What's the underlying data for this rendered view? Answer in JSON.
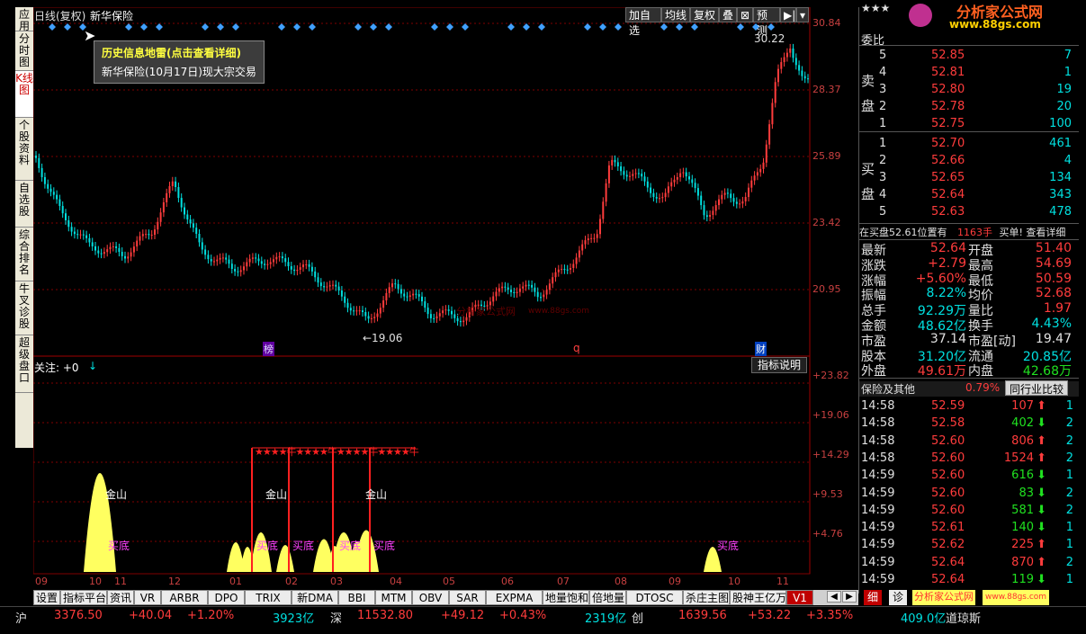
{
  "header": {
    "period": "日线(复权)",
    "stock": "新华保险",
    "buttons": [
      "加自选",
      "均线",
      "复权",
      "叠",
      "⊠",
      "预测",
      "▶|",
      "▾"
    ]
  },
  "left_tabs": [
    "应用",
    "分时图",
    "K线图",
    "个股资料",
    "自选股",
    "综合排名",
    "牛叉诊股",
    "超级盘口"
  ],
  "active_left_tab": 2,
  "tooltip": {
    "title": "历史信息地雷(点击查看详细)",
    "body": "新华保险(10月17日)现大宗交易"
  },
  "price_axis": [
    "30.84",
    "28.37",
    "25.89",
    "23.42",
    "20.95"
  ],
  "price_marks": {
    "high": "30.22",
    "low": "←19.06"
  },
  "events": [
    "榜",
    "q",
    "财"
  ],
  "indicator": {
    "label": "关注: +0",
    "explain": "指标说明",
    "axis": [
      "+23.82",
      "+19.06",
      "+14.29",
      "+9.53",
      "+4.76"
    ],
    "jinshan": "金山",
    "maidi": "买底",
    "stars": "★★★★牛★★★★牛★★★★牛★★★★牛"
  },
  "months": [
    "09",
    "10",
    "11",
    "12",
    "01",
    "02",
    "03",
    "04",
    "05",
    "06",
    "07",
    "08",
    "09",
    "10",
    "11"
  ],
  "watermark": "分析家公式网",
  "watermark_small": "www.88gs.com",
  "brand": {
    "name": "分析家公式网",
    "url": "www.88gs.com",
    "stars": "★★★"
  },
  "bottom_tabs": [
    "设置",
    "指标平台",
    "资讯",
    "VR",
    "ARBR",
    "DPO",
    "TRIX",
    "新DMA",
    "BBI",
    "MTM",
    "OBV",
    "SAR",
    "EXPMA",
    "地量饱和",
    "倍地量",
    "DTOSC",
    "杀庄主图",
    "股神王亿万",
    "V1"
  ],
  "bottom_right_tabs": [
    "细",
    "诊"
  ],
  "bottom_brand": "分析家公式网",
  "bottom_brand_url": "www.88gs.com",
  "orderbook": {
    "title": "委比",
    "sell_label": "卖盘",
    "buy_label": "买盘",
    "sells": [
      {
        "n": "5",
        "p": "52.85",
        "v": "7"
      },
      {
        "n": "4",
        "p": "52.81",
        "v": "1"
      },
      {
        "n": "3",
        "p": "52.80",
        "v": "19"
      },
      {
        "n": "2",
        "p": "52.78",
        "v": "20"
      },
      {
        "n": "1",
        "p": "52.75",
        "v": "100"
      }
    ],
    "buys": [
      {
        "n": "1",
        "p": "52.70",
        "v": "461"
      },
      {
        "n": "2",
        "p": "52.66",
        "v": "4"
      },
      {
        "n": "3",
        "p": "52.65",
        "v": "134"
      },
      {
        "n": "4",
        "p": "52.64",
        "v": "343"
      },
      {
        "n": "5",
        "p": "52.63",
        "v": "478"
      }
    ]
  },
  "notice": {
    "a": "在买盘52.61位置有",
    "b": "1163手",
    "c": "买单! 查看详细"
  },
  "stats": [
    {
      "l1": "最新",
      "v1": "52.64",
      "c1": "c-red",
      "l2": "开盘",
      "v2": "51.40",
      "c2": "c-red"
    },
    {
      "l1": "涨跌",
      "v1": "+2.79",
      "c1": "c-red",
      "l2": "最高",
      "v2": "54.69",
      "c2": "c-red"
    },
    {
      "l1": "涨幅",
      "v1": "+5.60%",
      "c1": "c-red",
      "l2": "最低",
      "v2": "50.59",
      "c2": "c-red"
    },
    {
      "l1": "振幅",
      "v1": "8.22%",
      "c1": "c-cy",
      "l2": "均价",
      "v2": "52.68",
      "c2": "c-red"
    },
    {
      "l1": "总手",
      "v1": "92.29万",
      "c1": "c-cy",
      "l2": "量比",
      "v2": "1.97",
      "c2": "c-red"
    },
    {
      "l1": "金额",
      "v1": "48.62亿",
      "c1": "c-cy",
      "l2": "换手",
      "v2": "4.43%",
      "c2": "c-cy"
    },
    {
      "l1": "市盈",
      "v1": "37.14",
      "c1": "c-wh",
      "l2": "市盈[动]",
      "v2": "19.47",
      "c2": "c-wh"
    },
    {
      "l1": "股本",
      "v1": "31.20亿",
      "c1": "c-cy",
      "l2": "流通",
      "v2": "20.85亿",
      "c2": "c-cy"
    },
    {
      "l1": "外盘",
      "v1": "49.61万",
      "c1": "c-red",
      "l2": "内盘",
      "v2": "42.68万",
      "c2": "c-grn"
    }
  ],
  "sector": {
    "name": "保险及其他",
    "pct": "0.79%",
    "btn": "同行业比较"
  },
  "ticks": [
    {
      "t": "14:58",
      "p": "52.59",
      "v": "107",
      "d": "up",
      "n": "1"
    },
    {
      "t": "14:58",
      "p": "52.58",
      "v": "402",
      "d": "down",
      "n": "2"
    },
    {
      "t": "14:58",
      "p": "52.60",
      "v": "806",
      "d": "up",
      "n": "2"
    },
    {
      "t": "14:58",
      "p": "52.60",
      "v": "1524",
      "d": "up",
      "n": "2"
    },
    {
      "t": "14:59",
      "p": "52.60",
      "v": "616",
      "d": "down",
      "n": "1"
    },
    {
      "t": "14:59",
      "p": "52.60",
      "v": "83",
      "d": "down",
      "n": "2"
    },
    {
      "t": "14:59",
      "p": "52.60",
      "v": "581",
      "d": "down",
      "n": "2"
    },
    {
      "t": "14:59",
      "p": "52.61",
      "v": "140",
      "d": "down",
      "n": "1"
    },
    {
      "t": "14:59",
      "p": "52.62",
      "v": "225",
      "d": "up",
      "n": "1"
    },
    {
      "t": "14:59",
      "p": "52.64",
      "v": "870",
      "d": "up",
      "n": "2"
    },
    {
      "t": "14:59",
      "p": "52.64",
      "v": "119",
      "d": "down",
      "n": "1"
    }
  ],
  "status": {
    "sh": "沪",
    "sh_v": "3376.50",
    "sh_c": "+40.04",
    "sh_p": "+1.20%",
    "sh_amt": "3923亿",
    "sz": "深",
    "sz_v": "11532.80",
    "sz_c": "+49.12",
    "sz_p": "+0.43%",
    "sz_amt": "2319亿",
    "cy": "创",
    "cy_v": "1639.56",
    "cy_c": "+53.22",
    "cy_p": "+3.35%",
    "dj_amt": "409.0亿",
    "dj": "道琼斯"
  },
  "colors": {
    "up": "#ff3c3c",
    "down": "#00e0e0",
    "indicator": "#ffff60",
    "grid": "#800000"
  }
}
